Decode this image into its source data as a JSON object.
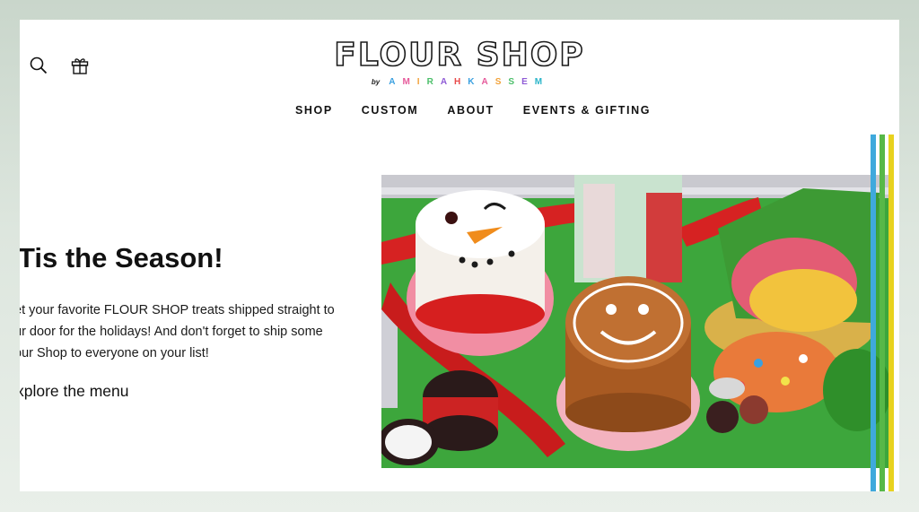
{
  "header": {
    "logo_text": "FLOUR SHOP",
    "logo_by": "by",
    "logo_sub_letters": [
      {
        "ch": "A",
        "color": "#3aa0e0"
      },
      {
        "ch": "M",
        "color": "#e65a9b"
      },
      {
        "ch": "I",
        "color": "#f2a23a"
      },
      {
        "ch": "R",
        "color": "#4cbf6a"
      },
      {
        "ch": "A",
        "color": "#8f5bd6"
      },
      {
        "ch": "H",
        "color": "#e84a4a"
      },
      {
        "ch": "K",
        "color": "#3aa0e0"
      },
      {
        "ch": "A",
        "color": "#e65a9b"
      },
      {
        "ch": "S",
        "color": "#f2a23a"
      },
      {
        "ch": "S",
        "color": "#4cbf6a"
      },
      {
        "ch": "E",
        "color": "#8f5bd6"
      },
      {
        "ch": "M",
        "color": "#2bb5c9"
      }
    ],
    "icons": [
      "search-icon",
      "gift-icon"
    ]
  },
  "nav": {
    "items": [
      "SHOP",
      "CUSTOM",
      "ABOUT",
      "EVENTS & GIFTING"
    ]
  },
  "hero": {
    "title": "Tis the Season!",
    "body_lines": [
      "et your favorite FLOUR SHOP treats shipped straight to",
      "ur door for the holidays! And don't forget to ship some",
      "our Shop to everyone on your list!"
    ],
    "link": "xplore the menu"
  },
  "decor": {
    "stripe_colors": [
      "#3fa9dc",
      "#57b848",
      "#e8d21e"
    ]
  }
}
